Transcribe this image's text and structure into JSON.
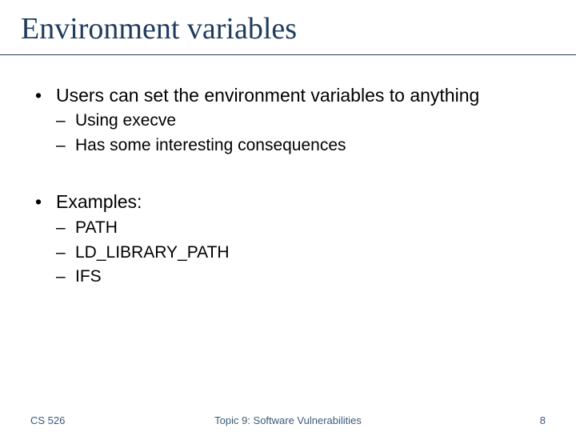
{
  "title": "Environment variables",
  "bullets": [
    {
      "text": "Users can set the environment variables to anything",
      "sub": [
        "Using execve",
        "Has some interesting consequences"
      ]
    },
    {
      "text": "Examples:",
      "sub": [
        "PATH",
        "LD_LIBRARY_PATH",
        "IFS"
      ]
    }
  ],
  "footer": {
    "left": "CS 526",
    "center": "Topic 9: Software Vulnerabilities",
    "right": "8"
  },
  "glyph": {
    "dot": "•",
    "dash": "–"
  }
}
